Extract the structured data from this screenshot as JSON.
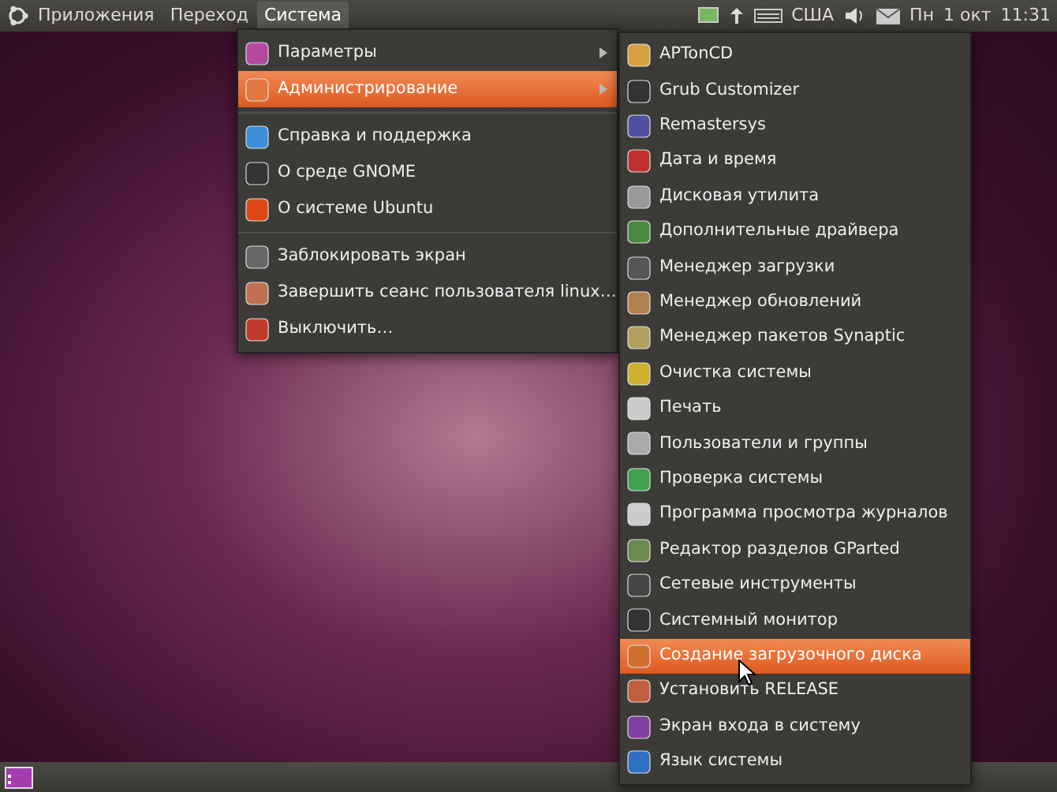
{
  "top_panel": {
    "menus": [
      {
        "label": "Приложения",
        "selected": false
      },
      {
        "label": "Переход",
        "selected": false
      },
      {
        "label": "Система",
        "selected": true
      }
    ],
    "tray": {
      "layout": "США",
      "day": "Пн",
      "date": "1 окт",
      "time": "11:31"
    }
  },
  "system_menu": {
    "items": [
      {
        "kind": "item",
        "label": "Параметры",
        "selected": false,
        "submenu": true
      },
      {
        "kind": "item",
        "label": "Администрирование",
        "selected": true,
        "submenu": true
      },
      {
        "kind": "separator"
      },
      {
        "kind": "item",
        "label": "Справка и поддержка",
        "selected": false,
        "submenu": false
      },
      {
        "kind": "item",
        "label": "О среде GNOME",
        "selected": false,
        "submenu": false
      },
      {
        "kind": "item",
        "label": "О системе Ubuntu",
        "selected": false,
        "submenu": false
      },
      {
        "kind": "separator"
      },
      {
        "kind": "item",
        "label": "Заблокировать экран",
        "selected": false,
        "submenu": false
      },
      {
        "kind": "item",
        "label": "Завершить сеанс пользователя linux…",
        "selected": false,
        "submenu": false
      },
      {
        "kind": "item",
        "label": "Выключить…",
        "selected": false,
        "submenu": false
      }
    ]
  },
  "admin_submenu": {
    "items": [
      {
        "label": "APTonCD",
        "selected": false
      },
      {
        "label": "Grub Customizer",
        "selected": false
      },
      {
        "label": "Remastersys",
        "selected": false
      },
      {
        "label": "Дата и время",
        "selected": false
      },
      {
        "label": "Дисковая утилита",
        "selected": false
      },
      {
        "label": "Дополнительные драйвера",
        "selected": false
      },
      {
        "label": "Менеджер загрузки",
        "selected": false
      },
      {
        "label": "Менеджер обновлений",
        "selected": false
      },
      {
        "label": "Менеджер пакетов Synaptic",
        "selected": false
      },
      {
        "label": "Очистка системы",
        "selected": false
      },
      {
        "label": "Печать",
        "selected": false
      },
      {
        "label": "Пользователи и группы",
        "selected": false
      },
      {
        "label": "Проверка системы",
        "selected": false
      },
      {
        "label": "Программа просмотра журналов",
        "selected": false
      },
      {
        "label": "Редактор разделов GParted",
        "selected": false
      },
      {
        "label": "Сетевые инструменты",
        "selected": false
      },
      {
        "label": "Системный монитор",
        "selected": false
      },
      {
        "label": "Создание загрузочного диска",
        "selected": true
      },
      {
        "label": "Установить RELEASE",
        "selected": false
      },
      {
        "label": "Экран входа в систему",
        "selected": false
      },
      {
        "label": "Язык системы",
        "selected": false
      }
    ]
  }
}
